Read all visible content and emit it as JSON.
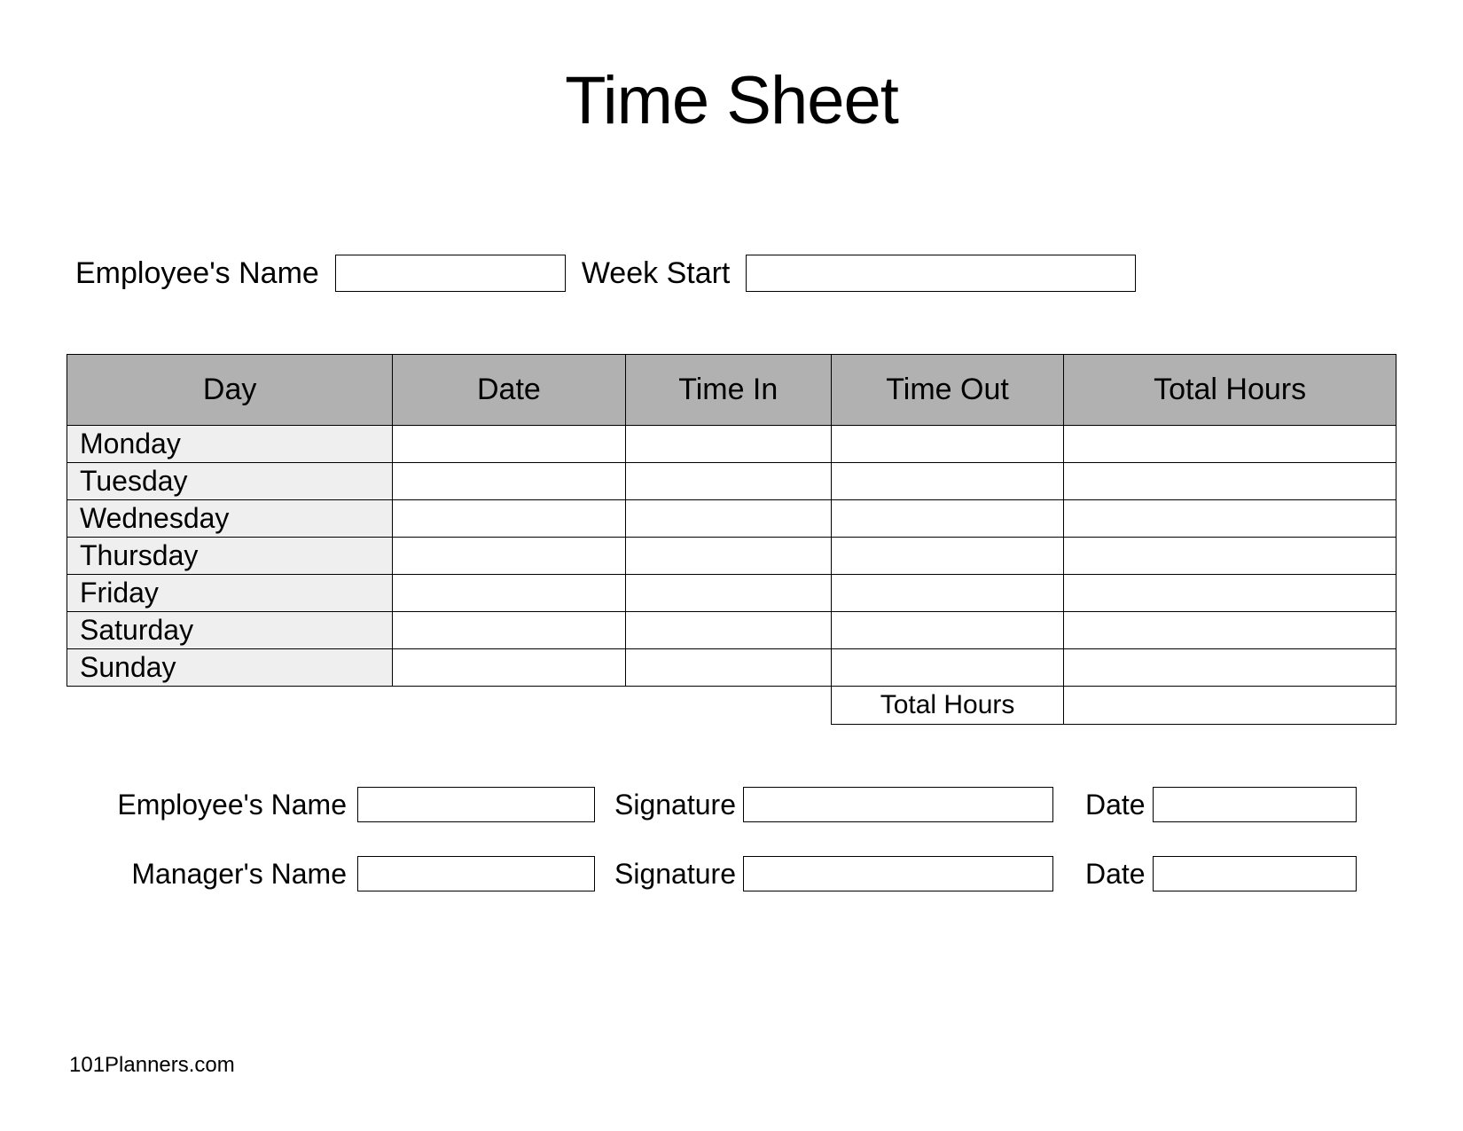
{
  "title": "Time Sheet",
  "header": {
    "employee_label": "Employee's Name",
    "week_start_label": "Week Start"
  },
  "table": {
    "headers": {
      "day": "Day",
      "date": "Date",
      "time_in": "Time In",
      "time_out": "Time Out",
      "total_hours": "Total Hours"
    },
    "rows": [
      {
        "day": "Monday",
        "date": "",
        "time_in": "",
        "time_out": "",
        "total": ""
      },
      {
        "day": "Tuesday",
        "date": "",
        "time_in": "",
        "time_out": "",
        "total": ""
      },
      {
        "day": "Wednesday",
        "date": "",
        "time_in": "",
        "time_out": "",
        "total": ""
      },
      {
        "day": "Thursday",
        "date": "",
        "time_in": "",
        "time_out": "",
        "total": ""
      },
      {
        "day": "Friday",
        "date": "",
        "time_in": "",
        "time_out": "",
        "total": ""
      },
      {
        "day": "Saturday",
        "date": "",
        "time_in": "",
        "time_out": "",
        "total": ""
      },
      {
        "day": "Sunday",
        "date": "",
        "time_in": "",
        "time_out": "",
        "total": ""
      }
    ],
    "total_label": "Total Hours",
    "total_value": ""
  },
  "signatures": {
    "employee": {
      "name_label": "Employee's Name",
      "sig_label": "Signature",
      "date_label": "Date"
    },
    "manager": {
      "name_label": "Manager's Name",
      "sig_label": "Signature",
      "date_label": "Date"
    }
  },
  "footer": "101Planners.com"
}
